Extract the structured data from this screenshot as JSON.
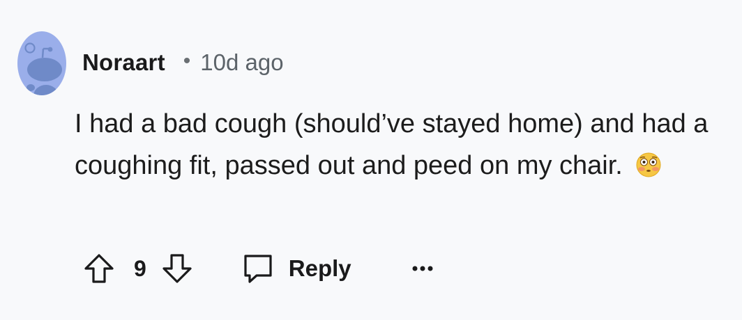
{
  "comment": {
    "author": "Noraart",
    "separator": "•",
    "timestamp": "10d ago",
    "text": "I had a bad cough (should’ve stayed home) and had a coughing fit, passed out and peed on my chair.",
    "emoji": "flushed-face-emoji",
    "avatar_icon": "snoo-avatar-icon",
    "avatar_color": "#9aaeea"
  },
  "actions": {
    "score": "9",
    "upvote_icon": "upvote-arrow-icon",
    "downvote_icon": "downvote-arrow-icon",
    "reply_label": "Reply",
    "reply_icon": "speech-bubble-icon",
    "more_icon": "ellipsis-icon"
  }
}
